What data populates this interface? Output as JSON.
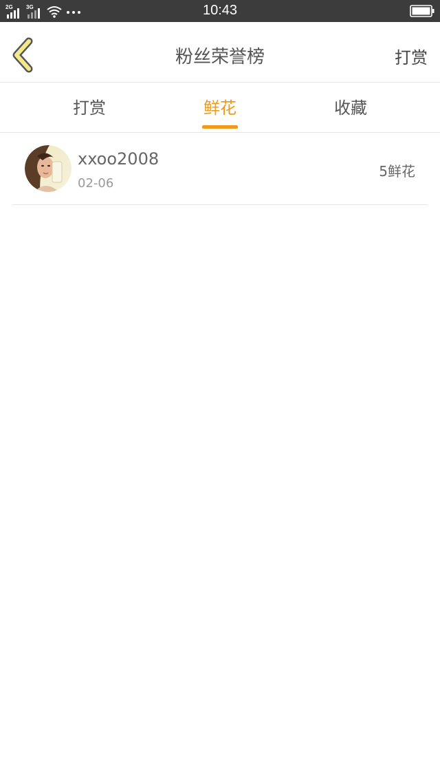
{
  "status_bar": {
    "sim1_type": "2G",
    "sim2_type": "3G",
    "time": "10:43"
  },
  "header": {
    "title": "粉丝荣誉榜",
    "right_action": "打赏"
  },
  "tabs": [
    {
      "label": "打赏",
      "active": false
    },
    {
      "label": "鲜花",
      "active": true
    },
    {
      "label": "收藏",
      "active": false
    }
  ],
  "list": [
    {
      "username": "xxoo2008",
      "date": "02-06",
      "amount": "5鲜花"
    }
  ],
  "colors": {
    "accent": "#ef9a1a",
    "back_arrow_fill": "#f3e98c",
    "status_bar_bg": "#3c3c3c"
  }
}
